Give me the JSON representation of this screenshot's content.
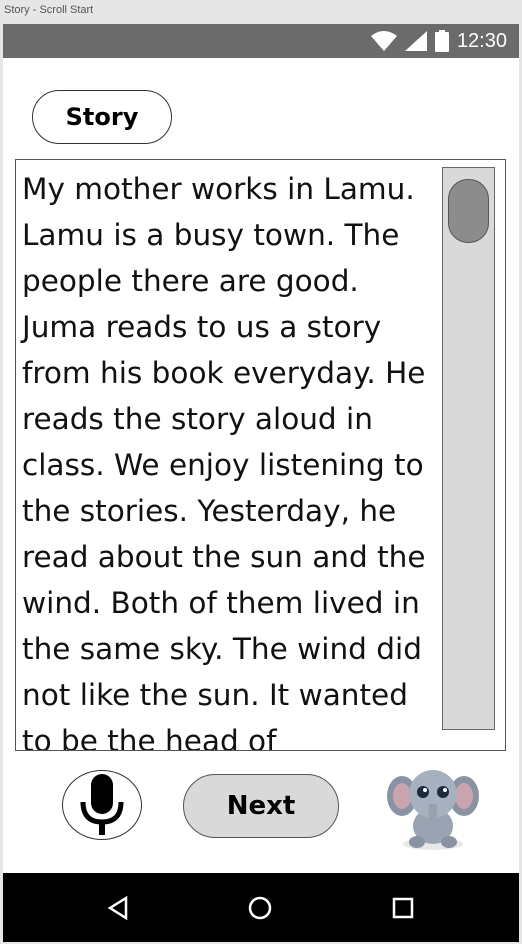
{
  "window": {
    "title": "Story - Scroll Start"
  },
  "status_bar": {
    "time": "12:30",
    "icons": [
      "wifi-icon",
      "signal-icon",
      "battery-icon"
    ]
  },
  "tab": {
    "label": "Story"
  },
  "story": {
    "text": "My mother works in Lamu. Lamu is a busy town. The people there are good. Juma reads to us a story from his book everyday. He reads the story aloud in class. We enjoy listening to the stories. Yesterday, he read about the sun and the wind. Both of them lived in the same sky. The wind did not like the sun. It wanted to be the head of",
    "scroll_position": 0
  },
  "controls": {
    "mic_icon": "microphone-icon",
    "next_label": "Next",
    "mascot": "elephant-mascot"
  },
  "nav": {
    "icons": [
      "back-icon",
      "home-icon",
      "recents-icon"
    ]
  },
  "colors": {
    "status_bar": "#6b6b6b",
    "nav_bar": "#000000",
    "button_fill": "#d9d9d9",
    "scroll_thumb": "#8c8c8c"
  }
}
